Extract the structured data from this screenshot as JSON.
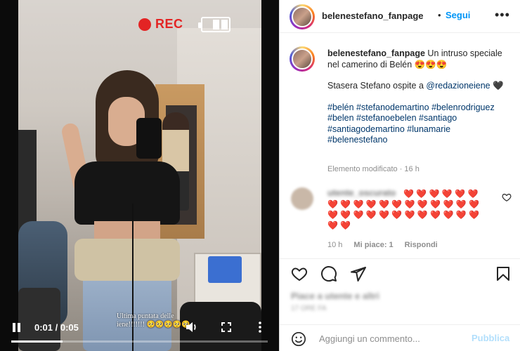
{
  "video": {
    "rec_label": "REC",
    "overlay_caption": "Ultima puntata delle iene!!!!!!! 🥺🥺🥺🥺🥺",
    "time": "0:01 / 0:05",
    "progress": 0.2
  },
  "header": {
    "username": "belenestefano_fanpage",
    "separator": "•",
    "follow_label": "Segui",
    "more_label": "•••"
  },
  "caption": {
    "username": "belenestefano_fanpage",
    "text": "Un intruso speciale nel camerino di Belén 😍😍😍",
    "line2_prefix": "Stasera Stefano ospite a",
    "mention": "@redazioneiene",
    "line2_suffix": "🖤",
    "hashtags": [
      "#belén",
      "#stefanodemartino",
      "#belenrodriguez",
      "#belen",
      "#stefanoebelen",
      "#santiago",
      "#santiagodemartino",
      "#lunamarie",
      "#belenestefano"
    ],
    "edited": "Elemento modificato · 16 h"
  },
  "comment": {
    "username": "utente_oscurato",
    "hearts": "❤️ ❤️ ❤️ ❤️ ❤️ ❤️ ❤️ ❤️ ❤️ ❤️ ❤️ ❤️ ❤️ ❤️ ❤️ ❤️ ❤️ ❤️ ❤️ ❤️ ❤️ ❤️ ❤️ ❤️ ❤️ ❤️ ❤️ ❤️ ❤️ ❤️ ❤️ ❤️",
    "time": "10 h",
    "likes": "Mi piace: 1",
    "reply": "Rispondi"
  },
  "post": {
    "likes_text": "Piace a utente e altri",
    "date_text": "17 ORE FA"
  },
  "composer": {
    "placeholder": "Aggiungi un commento...",
    "publish": "Pubblica"
  },
  "colors": {
    "accent": "#0095f6",
    "link": "#00376b",
    "rec": "#e32424",
    "heart": "#e0245e"
  }
}
